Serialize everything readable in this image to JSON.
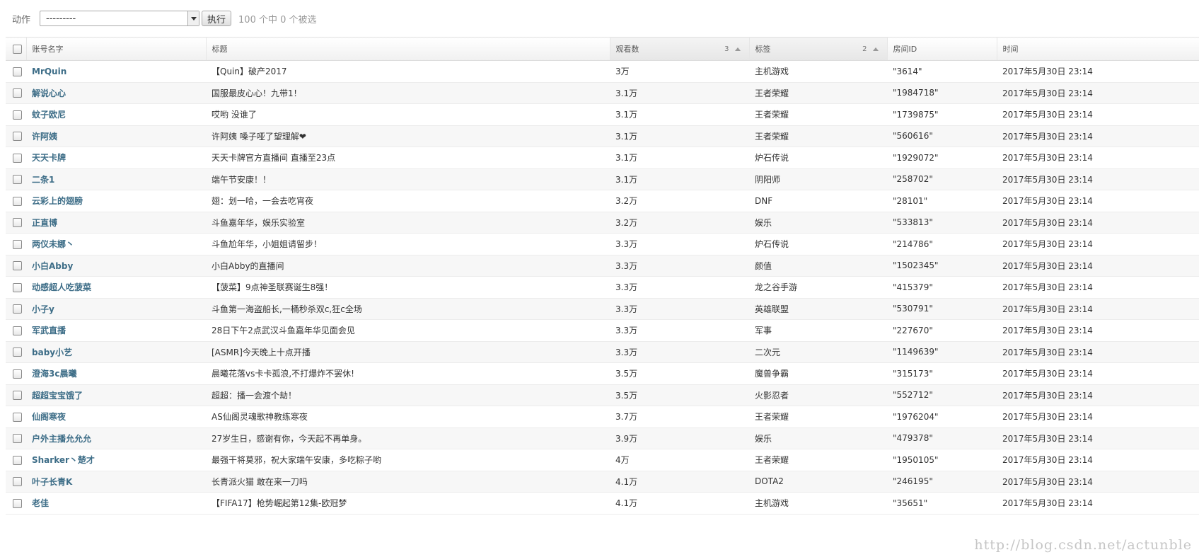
{
  "actions": {
    "label": "动作",
    "select_value": "---------",
    "run_label": "执行",
    "counter": "100 个中 0 个被选"
  },
  "table": {
    "headers": {
      "account": "账号名字",
      "title": "标题",
      "views": "观看数",
      "views_sort_rank": "3",
      "tag": "标签",
      "tag_sort_rank": "2",
      "room_id": "房间ID",
      "time": "时间"
    },
    "rows": [
      {
        "account": "MrQuin",
        "title": "【Quin】破产2017",
        "views": "3万",
        "tag": "主机游戏",
        "room_id": "\"3614\"",
        "time": "2017年5月30日 23:14"
      },
      {
        "account": "解说心心",
        "title": "国服最皮心心！九带1！",
        "views": "3.1万",
        "tag": "王者荣耀",
        "room_id": "\"1984718\"",
        "time": "2017年5月30日 23:14"
      },
      {
        "account": "蚊子欧尼",
        "title": "哎哟 没谁了",
        "views": "3.1万",
        "tag": "王者荣耀",
        "room_id": "\"1739875\"",
        "time": "2017年5月30日 23:14"
      },
      {
        "account": "许阿姨",
        "title": "许阿姨 嗓子哑了望理解❤",
        "views": "3.1万",
        "tag": "王者荣耀",
        "room_id": "\"560616\"",
        "time": "2017年5月30日 23:14"
      },
      {
        "account": "天天卡牌",
        "title": "天天卡牌官方直播间 直播至23点",
        "views": "3.1万",
        "tag": "炉石传说",
        "room_id": "\"1929072\"",
        "time": "2017年5月30日 23:14"
      },
      {
        "account": "二条1",
        "title": "端午节安康！！",
        "views": "3.1万",
        "tag": "阴阳师",
        "room_id": "\"258702\"",
        "time": "2017年5月30日 23:14"
      },
      {
        "account": "云彩上的翅膀",
        "title": "翅：划一哈，一会去吃宵夜",
        "views": "3.2万",
        "tag": "DNF",
        "room_id": "\"28101\"",
        "time": "2017年5月30日 23:14"
      },
      {
        "account": "正直博",
        "title": "斗鱼嘉年华，娱乐实验室",
        "views": "3.2万",
        "tag": "娱乐",
        "room_id": "\"533813\"",
        "time": "2017年5月30日 23:14"
      },
      {
        "account": "两仪未娜丶",
        "title": "斗鱼尬年华，小姐姐请留步！",
        "views": "3.3万",
        "tag": "炉石传说",
        "room_id": "\"214786\"",
        "time": "2017年5月30日 23:14"
      },
      {
        "account": "小白Abby",
        "title": "小白Abby的直播间",
        "views": "3.3万",
        "tag": "颜值",
        "room_id": "\"1502345\"",
        "time": "2017年5月30日 23:14"
      },
      {
        "account": "动感超人吃菠菜",
        "title": "【菠菜】9点神圣联赛诞生8强！",
        "views": "3.3万",
        "tag": "龙之谷手游",
        "room_id": "\"415379\"",
        "time": "2017年5月30日 23:14"
      },
      {
        "account": "小子y",
        "title": "斗鱼第一海盗船长,一桶秒杀双c,狂c全场",
        "views": "3.3万",
        "tag": "英雄联盟",
        "room_id": "\"530791\"",
        "time": "2017年5月30日 23:14"
      },
      {
        "account": "军武直播",
        "title": "28日下午2点武汉斗鱼嘉年华见面会见",
        "views": "3.3万",
        "tag": "军事",
        "room_id": "\"227670\"",
        "time": "2017年5月30日 23:14"
      },
      {
        "account": "baby小艺",
        "title": "[ASMR]今天晚上十点开播",
        "views": "3.3万",
        "tag": "二次元",
        "room_id": "\"1149639\"",
        "time": "2017年5月30日 23:14"
      },
      {
        "account": "澄海3c晨曦",
        "title": "晨曦花落vs卡卡孤浪,不打爆炸不罢休!",
        "views": "3.5万",
        "tag": "魔兽争霸",
        "room_id": "\"315173\"",
        "time": "2017年5月30日 23:14"
      },
      {
        "account": "超超宝宝饿了",
        "title": "超超：播一会渡个劫！",
        "views": "3.5万",
        "tag": "火影忍者",
        "room_id": "\"552712\"",
        "time": "2017年5月30日 23:14"
      },
      {
        "account": "仙阁寒夜",
        "title": "AS仙阁灵魂歌神教练寒夜",
        "views": "3.7万",
        "tag": "王者荣耀",
        "room_id": "\"1976204\"",
        "time": "2017年5月30日 23:14"
      },
      {
        "account": "户外主播允允允",
        "title": "27岁生日，感谢有你，今天起不再单身。",
        "views": "3.9万",
        "tag": "娱乐",
        "room_id": "\"479378\"",
        "time": "2017年5月30日 23:14"
      },
      {
        "account": "Sharker丶楚才",
        "title": "最强干将莫邪，祝大家端午安康，多吃粽子哟",
        "views": "4万",
        "tag": "王者荣耀",
        "room_id": "\"1950105\"",
        "time": "2017年5月30日 23:14"
      },
      {
        "account": "叶子长青K",
        "title": "长青派火猫 敢在来一刀吗",
        "views": "4.1万",
        "tag": "DOTA2",
        "room_id": "\"246195\"",
        "time": "2017年5月30日 23:14"
      },
      {
        "account": "老佳",
        "title": "【FIFA17】枪势崛起第12集-欧冠梦",
        "views": "4.1万",
        "tag": "主机游戏",
        "room_id": "\"35651\"",
        "time": "2017年5月30日 23:14"
      }
    ]
  },
  "watermark": "http://blog.csdn.net/actunble"
}
